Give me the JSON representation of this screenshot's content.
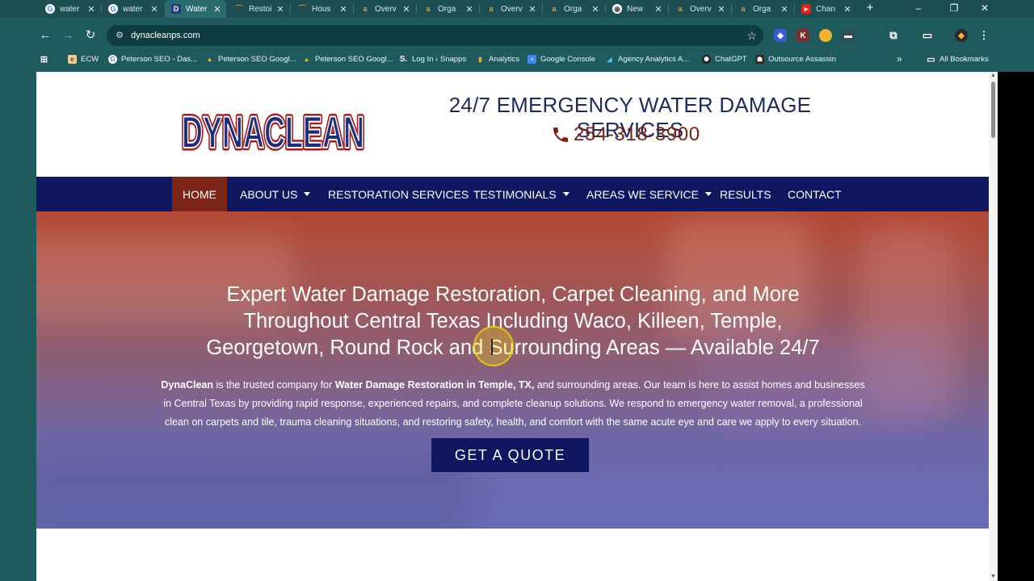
{
  "browser": {
    "tabs": [
      {
        "title": "water",
        "icon": "google-icon",
        "active": false
      },
      {
        "title": "water",
        "icon": "google-icon",
        "active": false
      },
      {
        "title": "Water",
        "icon": "dynaclean-favicon",
        "active": true
      },
      {
        "title": "Restoi",
        "icon": "restore-favicon",
        "active": false
      },
      {
        "title": "Hous",
        "icon": "house-favicon",
        "active": false
      },
      {
        "title": "Overv",
        "icon": "analytics-a-icon",
        "active": false
      },
      {
        "title": "Orga",
        "icon": "analytics-a-icon",
        "active": false
      },
      {
        "title": "Overv",
        "icon": "analytics-a-icon",
        "active": false
      },
      {
        "title": "Orga",
        "icon": "analytics-a-icon",
        "active": false
      },
      {
        "title": "New",
        "icon": "chrome-icon",
        "active": false
      },
      {
        "title": "Overv",
        "icon": "analytics-a-icon",
        "active": false
      },
      {
        "title": "Orga",
        "icon": "analytics-a-icon",
        "active": false
      },
      {
        "title": "Chan",
        "icon": "youtube-icon",
        "active": false
      }
    ],
    "url": "dynacleanps.com",
    "bookmarks": [
      {
        "label": "ECW",
        "icon": "ecw-icon"
      },
      {
        "label": "Peterson SEO - Das...",
        "icon": "google-icon"
      },
      {
        "label": "Peterson SEO Googl...",
        "icon": "google-ads-icon"
      },
      {
        "label": "Peterson SEO Googl...",
        "icon": "google-ads-icon"
      },
      {
        "label": "Log In ‹ Snapps",
        "icon": "snapps-icon"
      },
      {
        "label": "Analytics",
        "icon": "analytics-icon"
      },
      {
        "label": "Google Console",
        "icon": "search-console-icon"
      },
      {
        "label": "Agency Analytics A...",
        "icon": "agency-analytics-icon"
      },
      {
        "label": "ChatGPT",
        "icon": "chatgpt-icon"
      },
      {
        "label": "Outsource Assassin",
        "icon": "outsource-icon"
      }
    ],
    "all_bookmarks": "All Bookmarks"
  },
  "site": {
    "logo_text": "DYNACLEAN",
    "tagline": "24/7 EMERGENCY WATER DAMAGE SERVICES",
    "phone": "254-318-3900",
    "nav": [
      {
        "label": "HOME",
        "active": true,
        "dropdown": false
      },
      {
        "label": "ABOUT US",
        "active": false,
        "dropdown": true
      },
      {
        "label": "RESTORATION SERVICES",
        "active": false,
        "dropdown": false
      },
      {
        "label": "TESTIMONIALS",
        "active": false,
        "dropdown": true
      },
      {
        "label": "AREAS WE SERVICE",
        "active": false,
        "dropdown": true
      },
      {
        "label": "RESULTS",
        "active": false,
        "dropdown": false
      },
      {
        "label": "CONTACT",
        "active": false,
        "dropdown": false
      }
    ],
    "hero": {
      "heading_lines": [
        "Expert Water Damage Restoration, Carpet Cleaning, and More",
        "Throughout Central Texas Including Waco, Killeen, Temple,",
        "Georgetown, Round Rock and Surrounding Areas — Available 24/7"
      ],
      "body": {
        "brand": "DynaClean",
        "part1": " is the trusted company for ",
        "service": "Water Damage Restoration in Temple, TX,",
        "part2": " and surrounding areas. Our team is here to assist homes and businesses in Central Texas by providing rapid response, experienced repairs, and complete cleanup solutions.  We respond to emergency water removal, a professional clean on carpets and tile, trauma cleaning situations, and restoring safety, health, and comfort with the same acute eye and care we apply to every situation."
      },
      "cta": "GET A QUOTE"
    }
  },
  "colors": {
    "chrome_bg": "#1f5a5c",
    "nav_bg": "#0f1760",
    "nav_active": "#7c2418",
    "tagline": "#1d2a5e",
    "phone": "#7a2116"
  }
}
